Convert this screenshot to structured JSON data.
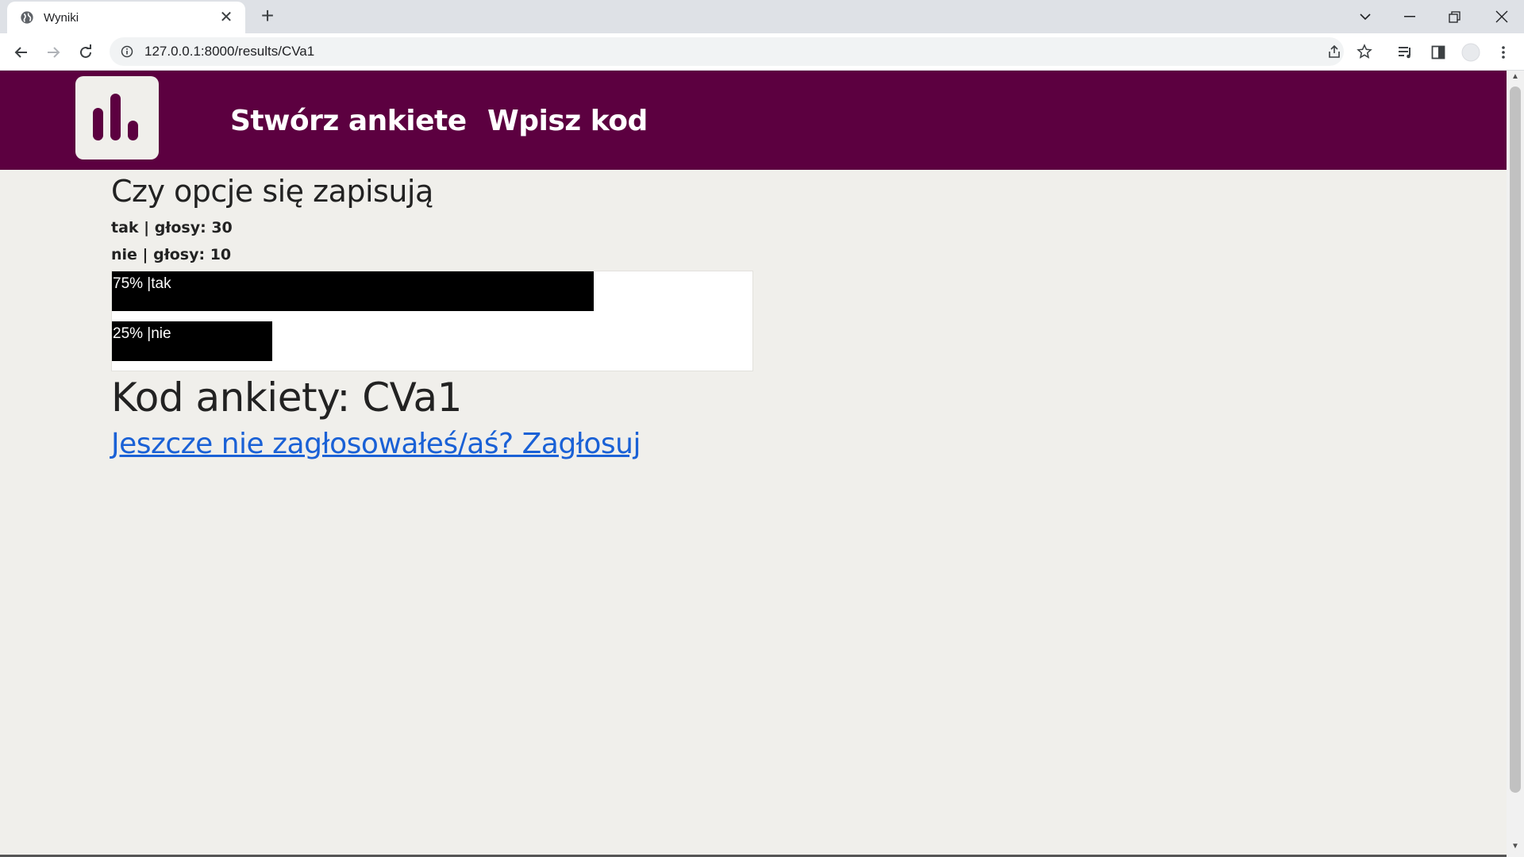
{
  "browser": {
    "tab_title": "Wyniki",
    "tab_close": "✕",
    "new_tab": "+",
    "url": "127.0.0.1:8000/results/CVa1"
  },
  "header": {
    "nav": [
      "Stwórz ankiete",
      "Wpisz kod"
    ],
    "background": "#5c0040"
  },
  "poll": {
    "title": "Czy opcje się zapisują",
    "votes": [
      {
        "text": "tak | głosy: 30",
        "option": "tak",
        "count": 30
      },
      {
        "text": "nie | głosy: 10",
        "option": "nie",
        "count": 10
      }
    ],
    "chart_data": {
      "type": "bar",
      "categories": [
        "tak",
        "nie"
      ],
      "values": [
        75,
        25
      ],
      "labels": [
        "75% |tak",
        "25% |nie"
      ]
    },
    "code_text": "Kod ankiety: CVa1",
    "vote_link": "Jeszcze nie zagłosowałeś/aś? Zagłosuj"
  },
  "colors": {
    "link": "#1a61d6",
    "bar": "#000000",
    "page_bg": "#f0efeb"
  }
}
